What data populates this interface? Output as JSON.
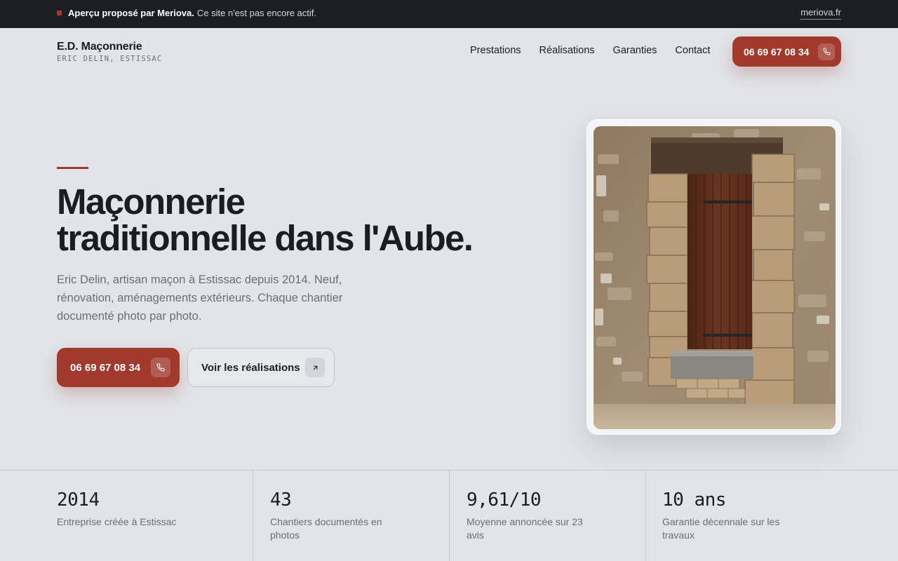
{
  "banner": {
    "strong": "Aperçu proposé par Meriova.",
    "text": "Ce site n'est pas encore actif.",
    "link": "meriova.fr"
  },
  "header": {
    "logo_name": "E.D. Maçonnerie",
    "logo_sub": "ERIC DELIN, ESTISSAC",
    "nav": [
      "Prestations",
      "Réalisations",
      "Garanties",
      "Contact"
    ],
    "phone": "06 69 67 08 34"
  },
  "hero": {
    "title_line1": "Maçonnerie",
    "title_line2": "traditionnelle dans l'Aube.",
    "description": "Eric Delin, artisan maçon à Estissac depuis 2014. Neuf, rénovation, aménagements extérieurs. Chaque chantier documenté photo par photo.",
    "cta_phone": "06 69 67 08 34",
    "cta_secondary": "Voir les réalisations"
  },
  "stats": [
    {
      "value": "2014",
      "label": "Entreprise créée à Estissac"
    },
    {
      "value": "43",
      "label": "Chantiers documentés en photos"
    },
    {
      "value": "9,61/10",
      "label": "Moyenne annoncée sur 23 avis"
    },
    {
      "value": "10 ans",
      "label": "Garantie décennale sur les travaux"
    }
  ],
  "colors": {
    "accent": "#a13a2d",
    "background": "#e1e4e8",
    "banner": "#1b1e22",
    "text": "#1b1d20",
    "muted": "#6a6f76"
  },
  "icons": {
    "phone": "phone-icon",
    "arrow": "arrow-up-right-icon"
  }
}
